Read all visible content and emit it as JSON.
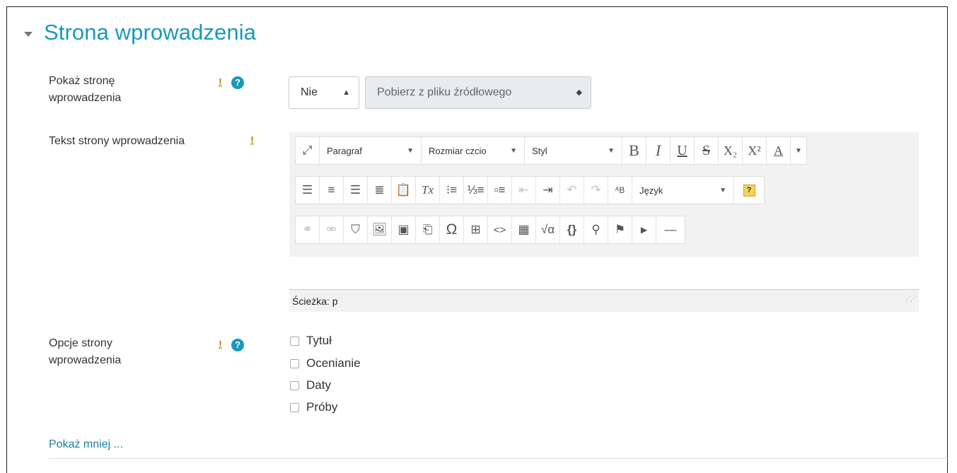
{
  "section": {
    "title": "Strona wprowadzenia"
  },
  "show_intro": {
    "label": "Pokaż stronę wprowadzenia",
    "label_line1": "Pokaż stronę",
    "label_line2": "wprowadzenia",
    "required_mark": "!",
    "help_mark": "?",
    "select_value": "Nie",
    "source_select_value": "Pobierz z pliku źródłowego"
  },
  "intro_text": {
    "label": "Tekst strony wprowadzenia",
    "required_mark": "!",
    "toolbar": {
      "paragraph": "Paragraf",
      "font_size": "Rozmiar czcio",
      "style": "Styl",
      "language": "Język",
      "help": "?"
    },
    "path_label": "Ścieżka: p"
  },
  "intro_options": {
    "label_line1": "Opcje strony",
    "label_line2": "wprowadzenia",
    "required_mark": "!",
    "help_mark": "?",
    "options": [
      "Tytuł",
      "Ocenianie",
      "Daty",
      "Próby"
    ]
  },
  "show_less_link": "Pokaż mniej ...",
  "icons": {
    "collapse": "triangle-down-icon",
    "fullscreen": "expand-arrows-icon",
    "bold": "B",
    "italic": "I",
    "underline": "U",
    "strikethrough": "S",
    "subscript": "X₂",
    "superscript": "X²",
    "font_color": "A",
    "omega": "Ω",
    "code": "<>"
  },
  "colors": {
    "accent": "#1899ba",
    "link": "#1a7fa4",
    "required": "#c08a00",
    "editor_bg": "#f2f2f2",
    "disabled_select": "#e9ecef"
  }
}
